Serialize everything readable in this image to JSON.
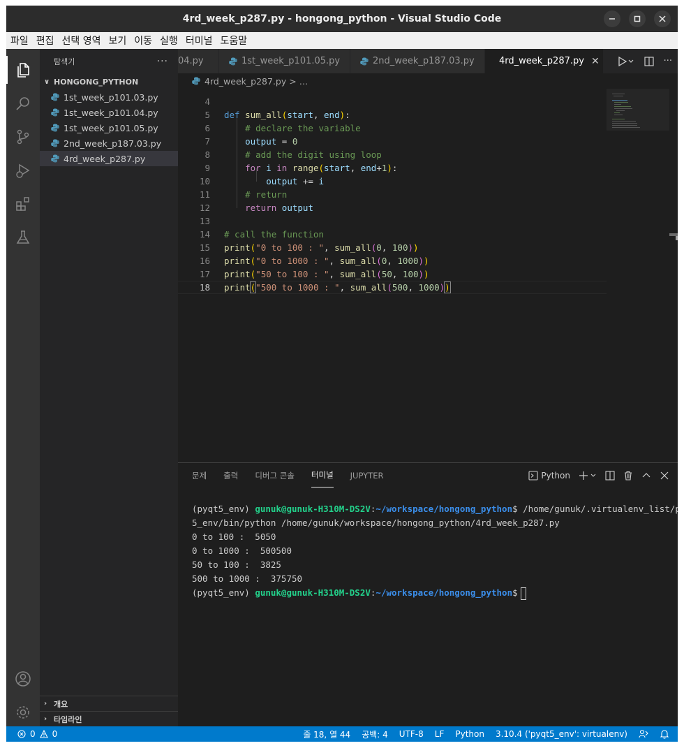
{
  "window": {
    "title": "4rd_week_p287.py - hongong_python - Visual Studio Code"
  },
  "menu": [
    "파일",
    "편집",
    "선택 영역",
    "보기",
    "이동",
    "실행",
    "터미널",
    "도움말"
  ],
  "sidebar": {
    "header": "탐색기",
    "more": "···",
    "folder": "HONGONG_PYTHON",
    "files": [
      {
        "name": "1st_week_p101.03.py"
      },
      {
        "name": "1st_week_p101.04.py"
      },
      {
        "name": "1st_week_p101.05.py"
      },
      {
        "name": "2nd_week_p187.03.py"
      },
      {
        "name": "4rd_week_p287.py"
      }
    ],
    "outline": "개요",
    "timeline": "타임라인"
  },
  "tabs": [
    {
      "label": "04.py"
    },
    {
      "label": "1st_week_p101.05.py"
    },
    {
      "label": "2nd_week_p187.03.py"
    },
    {
      "label": "4rd_week_p287.py"
    }
  ],
  "breadcrumb": {
    "file": "4rd_week_p287.py",
    "sep": " > ...",
    "sep_text": "> …"
  },
  "editor": {
    "line_numbers": [
      "4",
      "5",
      "6",
      "7",
      "8",
      "9",
      "10",
      "11",
      "12",
      "13",
      "14",
      "15",
      "16",
      "17",
      "18"
    ],
    "comments": {
      "declare": "# declare the variable",
      "add": "# add the digit using loop",
      "ret": "# return",
      "call": "# call the function"
    },
    "strings": {
      "s1": "\"0 to 100 : \"",
      "s2": "\"0 to 1000 : \"",
      "s3": "\"50 to 100 : \"",
      "s4": "\"500 to 1000 : \""
    }
  },
  "panel": {
    "tabs": [
      "문제",
      "출력",
      "디버그 콘솔",
      "터미널",
      "JUPYTER"
    ],
    "profile": "Python",
    "terminal": {
      "env": "(pyqt5_env) ",
      "user": "gunuk@gunuk-H310M-DS2V",
      "path": "~/workspace/hongong_python",
      "cmd1": "$ /home/gunuk/.virtualenv_list/pyqt",
      "cmd2": "5_env/bin/python /home/gunuk/workspace/hongong_python/4rd_week_p287.py",
      "out1": "0 to 100 :  5050",
      "out2": "0 to 1000 :  500500",
      "out3": "50 to 100 :  3825",
      "out4": "500 to 1000 :  375750",
      "prompt_end": "$"
    }
  },
  "status": {
    "errors": "0",
    "warnings": "0",
    "position": "줄 18, 열 44",
    "spaces": "공백: 4",
    "encoding": "UTF-8",
    "eol": "LF",
    "language": "Python",
    "interpreter": "3.10.4 ('pyqt5_env': virtualenv)"
  },
  "colors": {
    "accent": "#007acc",
    "background": "#1e1e1e"
  }
}
